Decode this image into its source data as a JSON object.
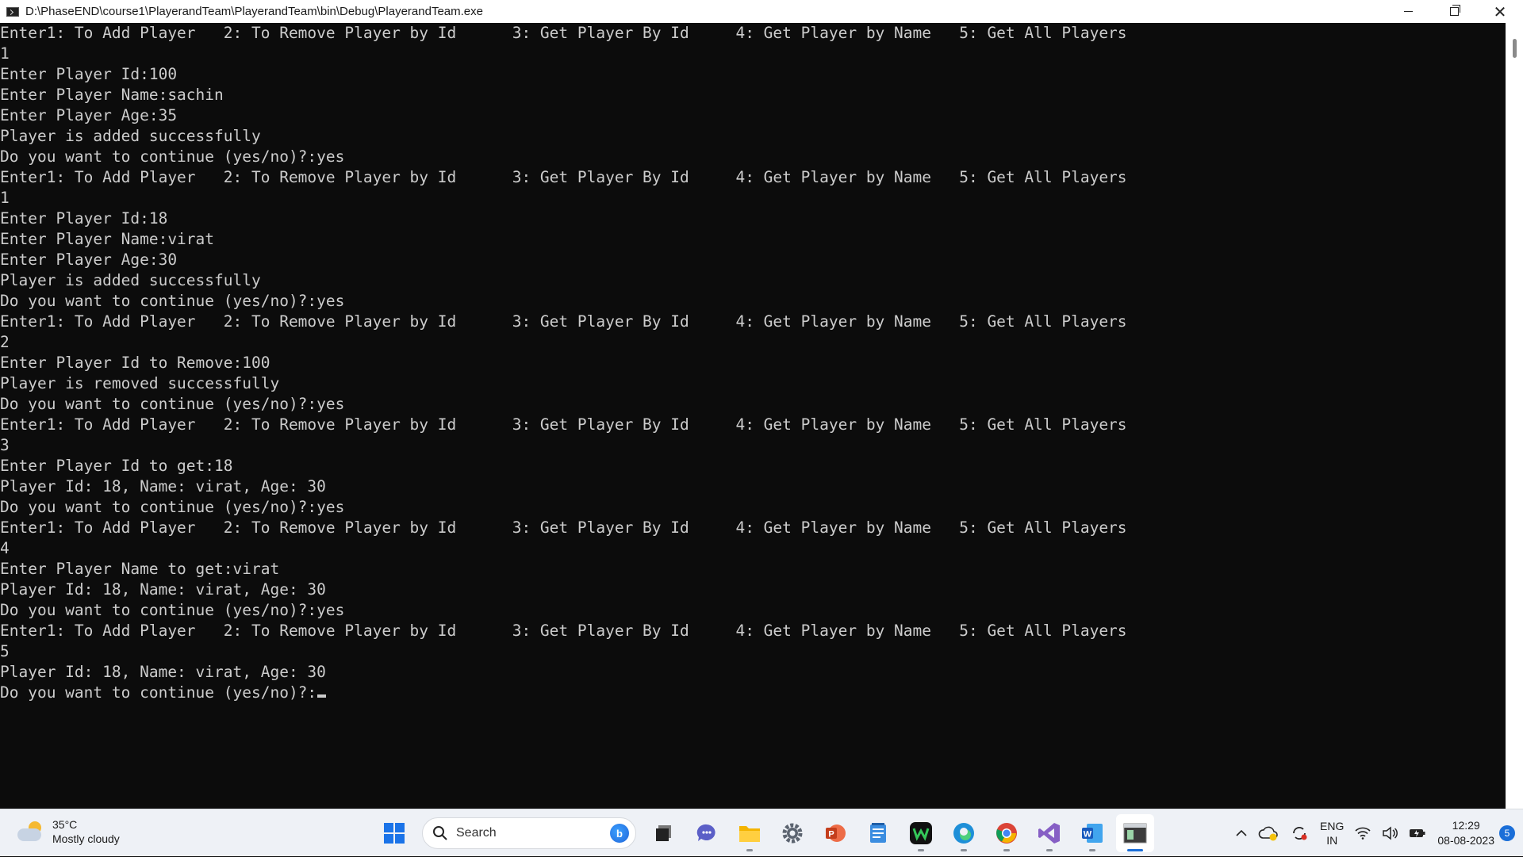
{
  "window": {
    "title": "D:\\PhaseEND\\course1\\PlayerandTeam\\PlayerandTeam\\bin\\Debug\\PlayerandTeam.exe",
    "minimize_icon": "minimize-icon",
    "maximize_icon": "restore-icon",
    "close_icon": "close-icon"
  },
  "console": {
    "lines": [
      "Enter1: To Add Player   2: To Remove Player by Id      3: Get Player By Id     4: Get Player by Name   5: Get All Players",
      "1",
      "Enter Player Id:100",
      "Enter Player Name:sachin",
      "Enter Player Age:35",
      "Player is added successfully",
      "Do you want to continue (yes/no)?:yes",
      "Enter1: To Add Player   2: To Remove Player by Id      3: Get Player By Id     4: Get Player by Name   5: Get All Players",
      "1",
      "Enter Player Id:18",
      "Enter Player Name:virat",
      "Enter Player Age:30",
      "Player is added successfully",
      "Do you want to continue (yes/no)?:yes",
      "Enter1: To Add Player   2: To Remove Player by Id      3: Get Player By Id     4: Get Player by Name   5: Get All Players",
      "2",
      "Enter Player Id to Remove:100",
      "Player is removed successfully",
      "Do you want to continue (yes/no)?:yes",
      "Enter1: To Add Player   2: To Remove Player by Id      3: Get Player By Id     4: Get Player by Name   5: Get All Players",
      "3",
      "Enter Player Id to get:18",
      "Player Id: 18, Name: virat, Age: 30",
      "Do you want to continue (yes/no)?:yes",
      "Enter1: To Add Player   2: To Remove Player by Id      3: Get Player By Id     4: Get Player by Name   5: Get All Players",
      "4",
      "Enter Player Name to get:virat",
      "Player Id: 18, Name: virat, Age: 30",
      "Do you want to continue (yes/no)?:yes",
      "Enter1: To Add Player   2: To Remove Player by Id      3: Get Player By Id     4: Get Player by Name   5: Get All Players",
      "5",
      "Player Id: 18, Name: virat, Age: 30",
      "Do you want to continue (yes/no)?:"
    ],
    "text_color": "#cccccc",
    "background": "#0c0c0c"
  },
  "taskbar": {
    "weather": {
      "temp": "35°C",
      "condition": "Mostly cloudy"
    },
    "search": {
      "label": "Search"
    },
    "apps": [
      "windows-start-icon",
      "task-view-icon",
      "teams-chat-icon",
      "file-explorer-icon",
      "settings-icon",
      "powerpoint-icon",
      "notepad-icon",
      "webex-icon",
      "edge-icon",
      "chrome-icon",
      "visual-studio-icon",
      "word-icon",
      "console-app-icon"
    ],
    "tray": {
      "language": {
        "line1": "ENG",
        "line2": "IN"
      },
      "time": "12:29",
      "date": "08-08-2023",
      "notifications": "5"
    },
    "accent": "#1a6ed8"
  }
}
